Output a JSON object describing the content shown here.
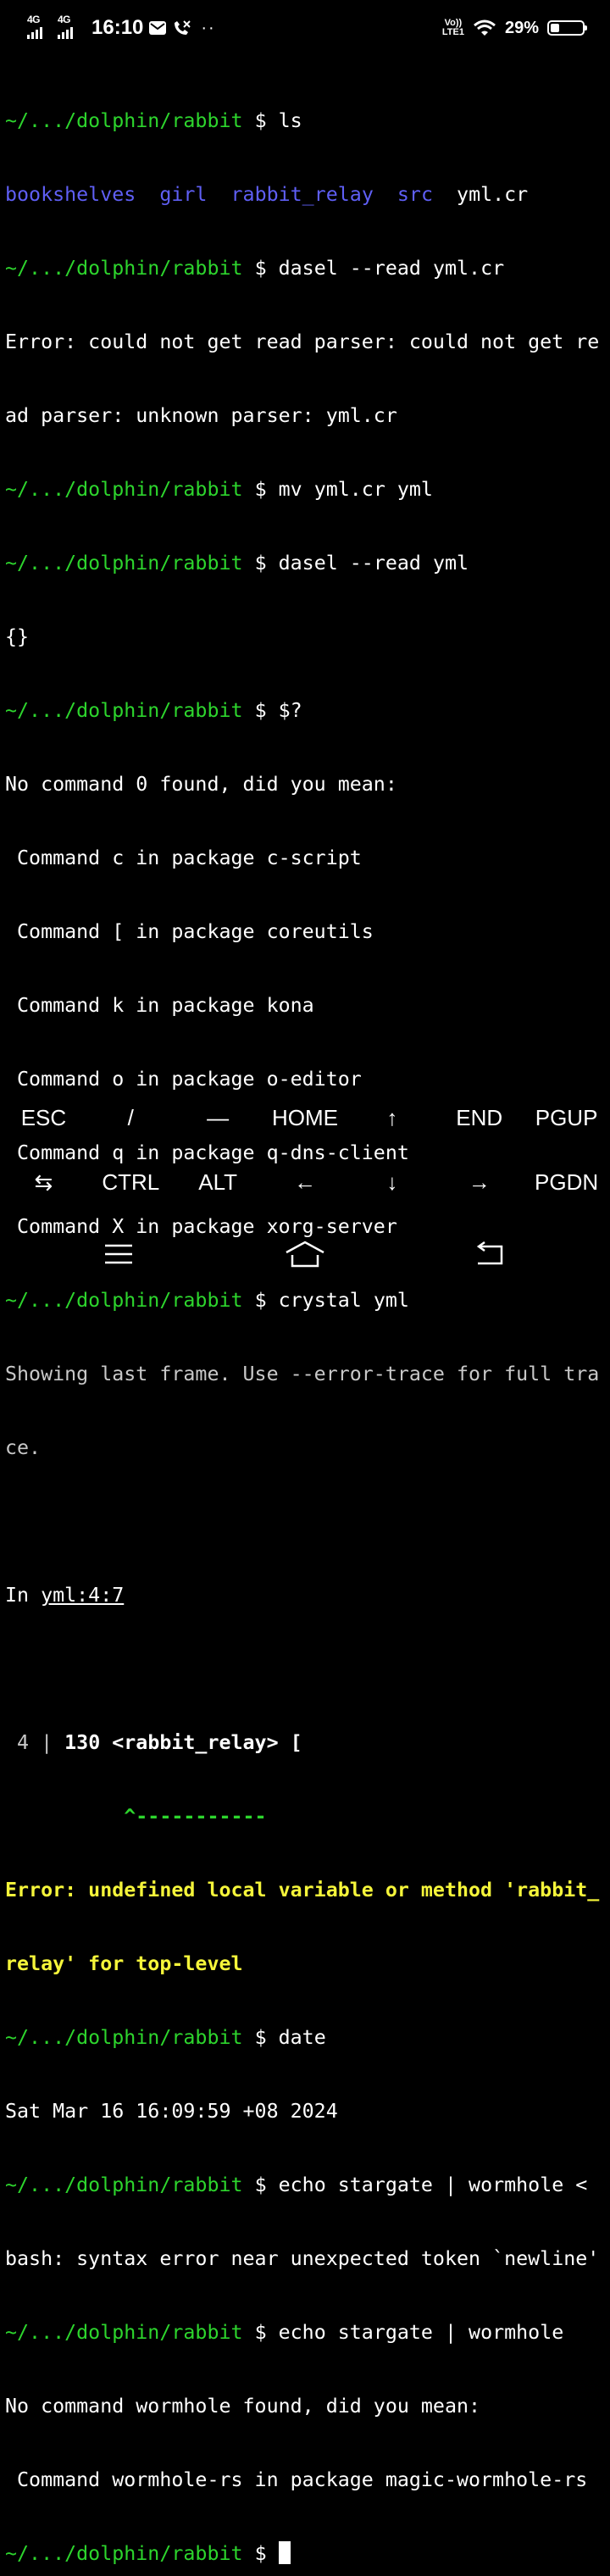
{
  "status_bar": {
    "sim1_label": "4G",
    "sim2_label": "4G",
    "time": "16:10",
    "more_indicator": "··",
    "volte_line1": "Vo))",
    "volte_line2": "LTE1",
    "battery_percent": "29%",
    "battery_level": 0.29,
    "icons": [
      "signal-icon",
      "signal-icon",
      "mail-icon",
      "missed-call-icon",
      "volte-icon",
      "wifi-icon",
      "battery-icon"
    ]
  },
  "terminal": {
    "colors": {
      "prompt": "#2dd52d",
      "directory": "#5f5ff5",
      "error": "#f5f53a",
      "text": "#ffffff",
      "dim": "#c8c8c8"
    },
    "prompt": "~/.../dolphin/rabbit",
    "prompt_symbol": "$",
    "lines": {
      "cmd_ls": "ls",
      "ls_dir1": "bookshelves",
      "ls_dir2": "girl",
      "ls_dir3": "rabbit_relay",
      "ls_dir4": "src",
      "ls_file1": "yml.cr",
      "cmd_dasel1": "dasel --read yml.cr",
      "err_dasel_1": "Error: could not get read parser: could not get re",
      "err_dasel_2": "ad parser: unknown parser: yml.cr",
      "cmd_mv": "mv yml.cr yml",
      "cmd_dasel2": "dasel --read yml",
      "out_dasel2": "{}",
      "cmd_status": "$?",
      "notfound_0": "No command 0 found, did you mean:",
      "sugg_1": " Command c in package c-script",
      "sugg_2": " Command [ in package coreutils",
      "sugg_3": " Command k in package kona",
      "sugg_4": " Command o in package o-editor",
      "sugg_5": " Command q in package q-dns-client",
      "sugg_6": " Command X in package xorg-server",
      "cmd_crystal": "crystal yml",
      "crystal_info_1": "Showing last frame. Use --error-trace for full tra",
      "crystal_info_2": "ce.",
      "crystal_in_prefix": "In ",
      "crystal_in_file": "yml:4:7",
      "code_lineno": " 4 | ",
      "code_text": "130 <rabbit_relay> [",
      "code_caret": "          ^-----------",
      "crystal_err_1": "Error: undefined local variable or method 'rabbit_",
      "crystal_err_2": "relay' for top-level",
      "cmd_date": "date",
      "out_date": "Sat Mar 16 16:09:59 +08 2024",
      "cmd_echo1": "echo stargate | wormhole <",
      "err_bash": "bash: syntax error near unexpected token `newline'",
      "cmd_echo2": "echo stargate | wormhole",
      "notfound_wormhole": "No command wormhole found, did you mean:",
      "sugg_wormhole": " Command wormhole-rs in package magic-wormhole-rs"
    }
  },
  "extra_keys": {
    "row1": [
      "ESC",
      "/",
      "—",
      "HOME",
      "↑",
      "END",
      "PGUP"
    ],
    "row2": [
      "⇆",
      "CTRL",
      "ALT",
      "←",
      "↓",
      "→",
      "PGDN"
    ]
  },
  "nav_bar": {
    "icons": [
      "menu-icon",
      "home-icon",
      "back-icon"
    ]
  }
}
